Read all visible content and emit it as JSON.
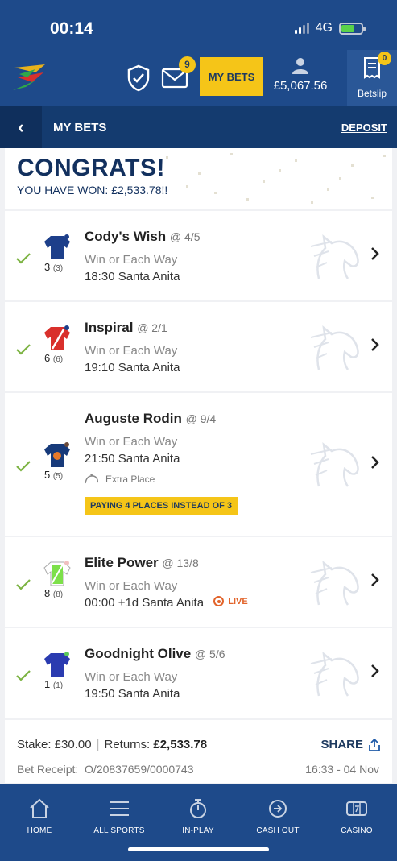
{
  "status": {
    "time": "00:14",
    "network": "4G"
  },
  "header": {
    "mail_badge": "9",
    "my_bets_label": "MY BETS",
    "balance": "£5,067.56",
    "betslip_label": "Betslip",
    "betslip_badge": "0"
  },
  "subheader": {
    "back": "‹",
    "title": "MY BETS",
    "deposit": "DEPOSIT"
  },
  "congrats": {
    "title": "CONGRATS!",
    "subtitle": "YOU HAVE WON: £2,533.78!!"
  },
  "selections": [
    {
      "horse": "Cody's Wish",
      "odds": "@ 4/5",
      "market": "Win or Each Way",
      "race": "18:30 Santa Anita",
      "number": "3",
      "draw": "(3)"
    },
    {
      "horse": "Inspiral",
      "odds": "@ 2/1",
      "market": "Win or Each Way",
      "race": "19:10 Santa Anita",
      "number": "6",
      "draw": "(6)"
    },
    {
      "horse": "Auguste Rodin",
      "odds": "@ 9/4",
      "market": "Win or Each Way",
      "race": "21:50 Santa Anita",
      "number": "5",
      "draw": "(5)",
      "extra": "Extra Place",
      "promo": "PAYING 4 PLACES INSTEAD OF 3"
    },
    {
      "horse": "Elite Power",
      "odds": "@ 13/8",
      "market": "Win or Each Way",
      "race": "00:00 +1d Santa Anita",
      "number": "8",
      "draw": "(8)",
      "live": "LIVE"
    },
    {
      "horse": "Goodnight Olive",
      "odds": "@ 5/6",
      "market": "Win or Each Way",
      "race": "19:50 Santa Anita",
      "number": "1",
      "draw": "(1)"
    }
  ],
  "summary": {
    "stake_label": "Stake:",
    "stake": "£30.00",
    "returns_label": "Returns:",
    "returns": "£2,533.78",
    "share": "SHARE",
    "receipt_label": "Bet Receipt:",
    "receipt": "O/20837659/0000743",
    "date": "16:33 - 04 Nov"
  },
  "nav": {
    "home": "HOME",
    "all_sports": "ALL SPORTS",
    "in_play": "IN-PLAY",
    "cash_out": "CASH OUT",
    "casino": "CASINO"
  },
  "colors": {
    "brand_blue": "#1e4a8a",
    "accent_yellow": "#f5c518",
    "win_green": "#7cb342",
    "live_orange": "#e2642b"
  }
}
